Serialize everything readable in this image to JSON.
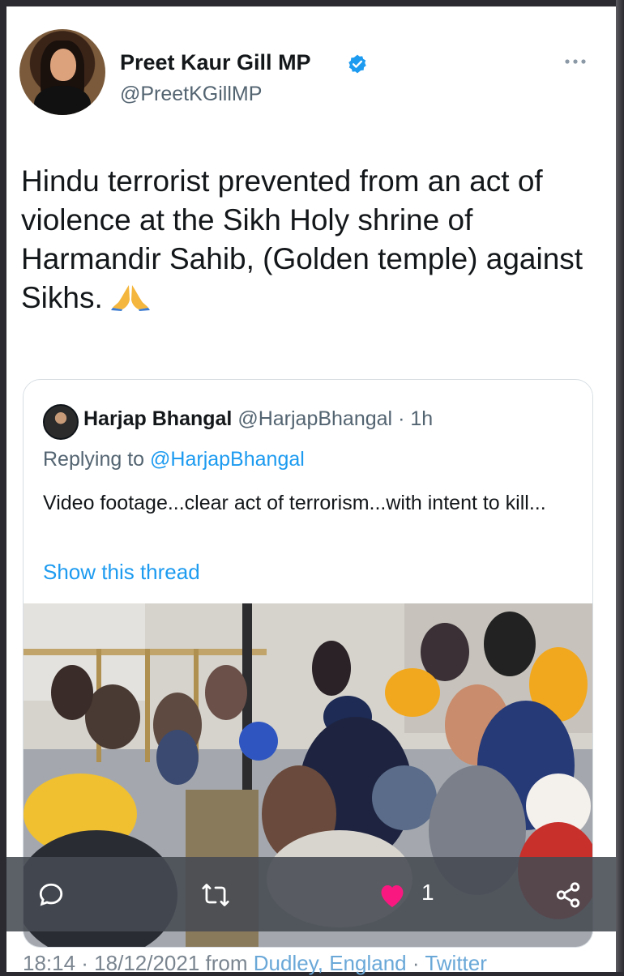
{
  "tweet": {
    "display_name": "Preet Kaur Gill MP",
    "handle": "@PreetKGillMP",
    "text": "Hindu terrorist prevented from an act of violence at the Sikh Holy shrine of Harmandir Sahib, (Golden temple) against Sikhs.",
    "verified": true
  },
  "quoted": {
    "display_name": "Harjap Bhangal",
    "handle": "@HarjapBhangal",
    "time": "· 1h",
    "replying_label": "Replying to",
    "replying_mention": "@HarjapBhangal",
    "text": "Video footage...clear act of terrorism...with intent to kill...",
    "show_thread": "Show this thread"
  },
  "actions": {
    "like_count": "1",
    "icons": [
      "reply-icon",
      "retweet-icon",
      "heart-icon",
      "share-icon"
    ]
  },
  "footer": {
    "time_date": "18:14 · 18/12/2021 from",
    "location": "Dudley, England",
    "separator": "·",
    "source": "Twitter"
  },
  "colors": {
    "link": "#1d9bf0",
    "verified": "#1d9bf0",
    "like": "#f91880",
    "text": "#14171a",
    "muted": "#536471"
  }
}
